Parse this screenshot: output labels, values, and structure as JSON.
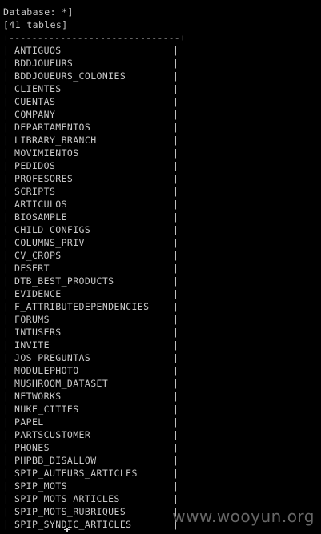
{
  "header": {
    "database_line": "Database: *]",
    "count_line": "[41 tables]"
  },
  "table": {
    "border_top": "+------------------------------+",
    "left_bar": "|",
    "right_bar": "|",
    "rows": [
      "ANTIGUOS",
      "BDDJOUEURS",
      "BDDJOUEURS_COLONIES",
      "CLIENTES",
      "CUENTAS",
      "COMPANY",
      "DEPARTAMENTOS",
      "LIBRARY_BRANCH",
      "MOVIMIENTOS",
      "PEDIDOS",
      "PROFESORES",
      "SCRIPTS",
      "ARTICULOS",
      "BIOSAMPLE",
      "CHILD_CONFIGS",
      "COLUMNS_PRIV",
      "CV_CROPS",
      "DESERT",
      "DTB_BEST_PRODUCTS",
      "EVIDENCE",
      "F_ATTRIBUTEDEPENDENCIES",
      "FORUMS",
      "INTUSERS",
      "INVITE",
      "JOS_PREGUNTAS",
      "MODULEPHOTO",
      "MUSHROOM_DATASET",
      "NETWORKS",
      "NUKE_CITIES",
      "PAPEL",
      "PARTSCUSTOMER",
      "PHONES",
      "PHPBB_DISALLOW",
      "SPIP_AUTEURS_ARTICLES",
      "SPIP_MOTS",
      "SPIP_MOTS_ARTICLES",
      "SPIP_MOTS_RUBRIQUES",
      "SPIP_SYNDIC_ARTICLES"
    ]
  },
  "watermark": "www.wooyun.org",
  "colors": {
    "background": "#000000",
    "text": "#c8c8c8",
    "watermark": "#8a8a8a"
  }
}
